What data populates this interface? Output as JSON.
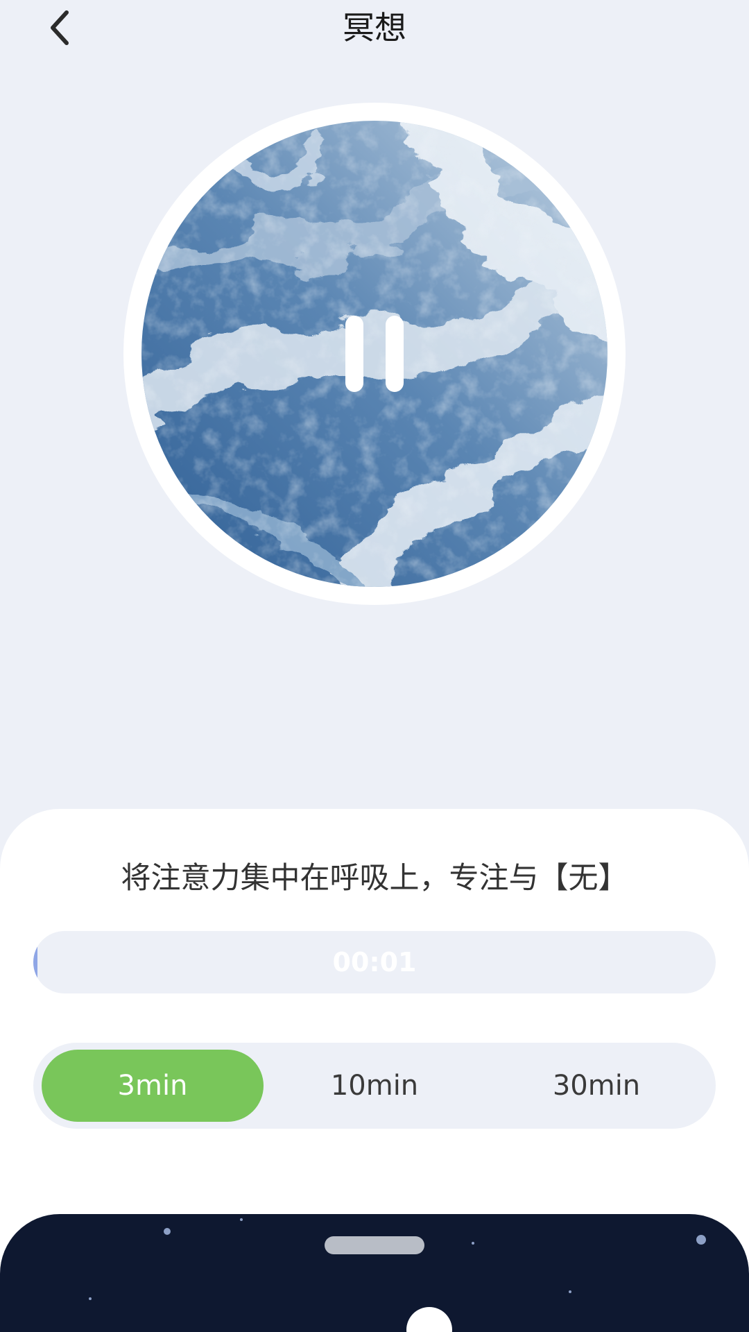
{
  "header": {
    "title": "冥想",
    "back_icon": "chevron-left-icon"
  },
  "player": {
    "state_icon": "pause-icon",
    "colors": {
      "ring": "#ffffff",
      "artwork_dark": "#3d6ea3",
      "artwork_light": "#dbe6f0"
    }
  },
  "session": {
    "focus_text": "将注意力集中在呼吸上，专注与【无】",
    "elapsed": "00:01",
    "progress_fraction": 0.005
  },
  "durations": {
    "options": [
      "3min",
      "10min",
      "30min"
    ],
    "selected_index": 0,
    "active_color": "#79c65a"
  },
  "bottom_sheet": {
    "background": "#0e1830"
  }
}
